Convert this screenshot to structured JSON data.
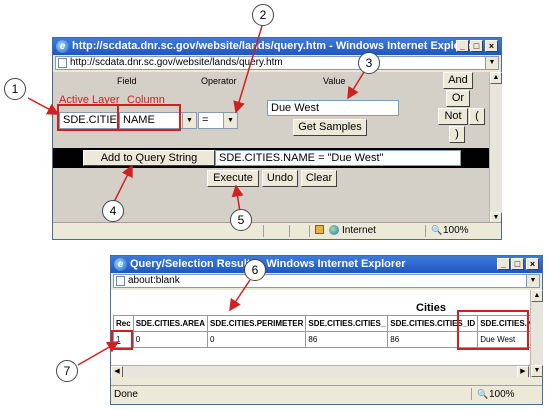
{
  "window1": {
    "title": "http://scdata.dnr.sc.gov/website/lands/query.htm - Windows Internet Explorer",
    "address": "http://scdata.dnr.sc.gov/website/lands/query.htm",
    "headers": {
      "field": "Field",
      "operator": "Operator",
      "value": "Value"
    },
    "labels": {
      "active_layer": "Active Layer",
      "column": "Column"
    },
    "layer_value": "SDE.CITIES",
    "column_value": "NAME",
    "operator_value": "=",
    "value_input": "Due West",
    "get_samples": "Get Samples",
    "logic_buttons": {
      "and": "And",
      "or": "Or",
      "not": "Not",
      "open_paren": "(",
      "close_paren": ")"
    },
    "add_to_query": "Add to Query String",
    "query_string": "SDE.CITIES.NAME  =  \"Due West\"",
    "execute": "Execute",
    "undo": "Undo",
    "clear": "Clear",
    "status_zone": "Internet",
    "zoom": "100%"
  },
  "window2": {
    "title": "Query/Selection Results - Windows Internet Explorer",
    "address": "about:blank",
    "table_title": "Cities",
    "columns": [
      "Rec",
      "SDE.CITIES.AREA",
      "SDE.CITIES.PERIMETER",
      "SDE.CITIES.CITIES_",
      "SDE.CITIES.CITIES_ID",
      "SDE.CITIES.NAME"
    ],
    "row": [
      "1",
      "0",
      "0",
      "86",
      "86",
      "Due West"
    ],
    "status": "Done",
    "zoom": "100%"
  },
  "callouts": [
    "1",
    "2",
    "3",
    "4",
    "5",
    "6",
    "7"
  ],
  "colors": {
    "annotation": "#d02020",
    "titlebar": "#1f56c4",
    "query_band": "#000000"
  },
  "icons": [
    "ie-icon",
    "page-icon",
    "lock-icon",
    "globe-icon",
    "zoom-icon"
  ]
}
